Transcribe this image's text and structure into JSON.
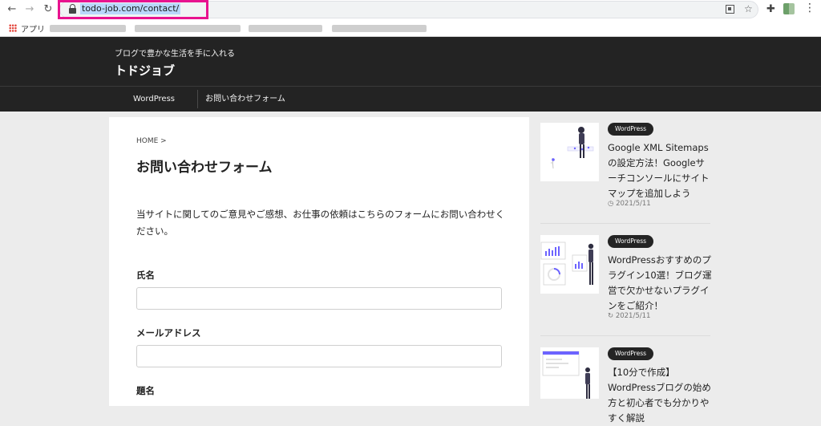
{
  "browser": {
    "url": "todo-job.com/contact/",
    "bookmarks_apps_label": "アプリ"
  },
  "site": {
    "tagline": "ブログで豊かな生活を手に入れる",
    "title": "トドジョブ",
    "nav": [
      "WordPress",
      "お問い合わせフォーム"
    ]
  },
  "main": {
    "breadcrumb": "HOME >",
    "title": "お問い合わせフォーム",
    "intro": "当サイトに関してのご意見やご感想、お仕事の依頼はこちらのフォームにお問い合わせください。",
    "fields": [
      {
        "label": "氏名",
        "value": ""
      },
      {
        "label": "メールアドレス",
        "value": ""
      },
      {
        "label": "題名",
        "value": ""
      }
    ]
  },
  "sidebar": {
    "posts": [
      {
        "category": "WordPress",
        "title": "Google XML Sitemapsの設定方法！Googleサーチコンソールにサイトマップを追加しよう",
        "date": "◷ 2021/5/11"
      },
      {
        "category": "WordPress",
        "title": "WordPressおすすめのプラグイン10選！ブログ運営で欠かせないプラグインをご紹介！",
        "date": "↻ 2021/5/11"
      },
      {
        "category": "WordPress",
        "title": "【10分で作成】WordPressブログの始め方と初心者でも分かりやすく解説",
        "date": ""
      }
    ]
  }
}
